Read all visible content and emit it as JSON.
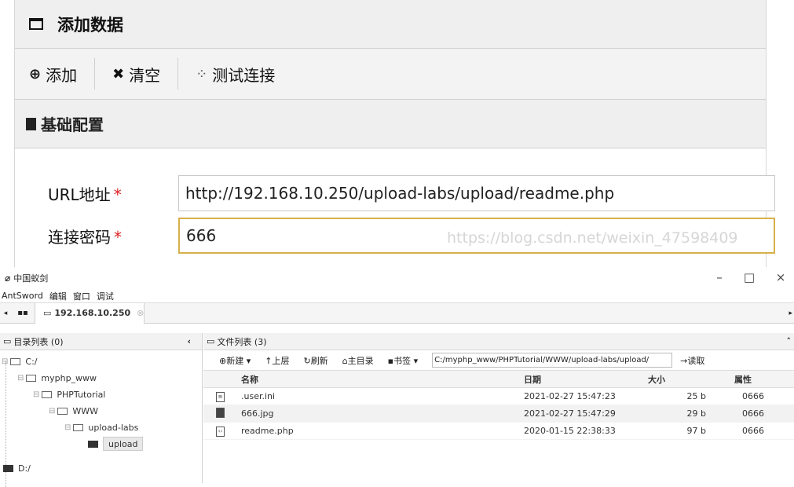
{
  "top": {
    "dialog_title": "添加数据",
    "toolbar": {
      "add": "添加",
      "clear": "清空",
      "test": "测试连接"
    },
    "section_title": "基础配置",
    "url_label": "URL地址",
    "url_value": "http://192.168.10.250/upload-labs/upload/readme.php",
    "pwd_label": "连接密码",
    "pwd_value": "666",
    "required_mark": "*",
    "watermark": "https://blog.csdn.net/weixin_47598409"
  },
  "antsword": {
    "window_title": "中国蚁剑",
    "menu": [
      "AntSword",
      "编辑",
      "窗口",
      "调试"
    ],
    "tab_label": "192.168.10.250",
    "dir_panel_title": "目录列表 (0)",
    "file_panel_title": "文件列表 (3)",
    "tree": [
      "C:/",
      "myphp_www",
      "PHPTutorial",
      "WWW",
      "upload-labs",
      "upload",
      "D:/"
    ],
    "file_toolbar": {
      "new": "新建",
      "up": "上层",
      "refresh": "刷新",
      "home": "主目录",
      "bookmark": "书签",
      "read": "读取"
    },
    "path": "C:/myphp_www/PHPTutorial/WWW/upload-labs/upload/",
    "columns": {
      "name": "名称",
      "date": "日期",
      "size": "大小",
      "attr": "属性"
    },
    "files": [
      {
        "name": ".user.ini",
        "date": "2021-02-27 15:47:23",
        "size": "25 b",
        "attr": "0666",
        "icon": "text-file-icon"
      },
      {
        "name": "666.jpg",
        "date": "2021-02-27 15:47:29",
        "size": "29 b",
        "attr": "0666",
        "icon": "image-file-icon"
      },
      {
        "name": "readme.php",
        "date": "2020-01-15 22:38:33",
        "size": "97 b",
        "attr": "0666",
        "icon": "code-file-icon"
      }
    ]
  }
}
